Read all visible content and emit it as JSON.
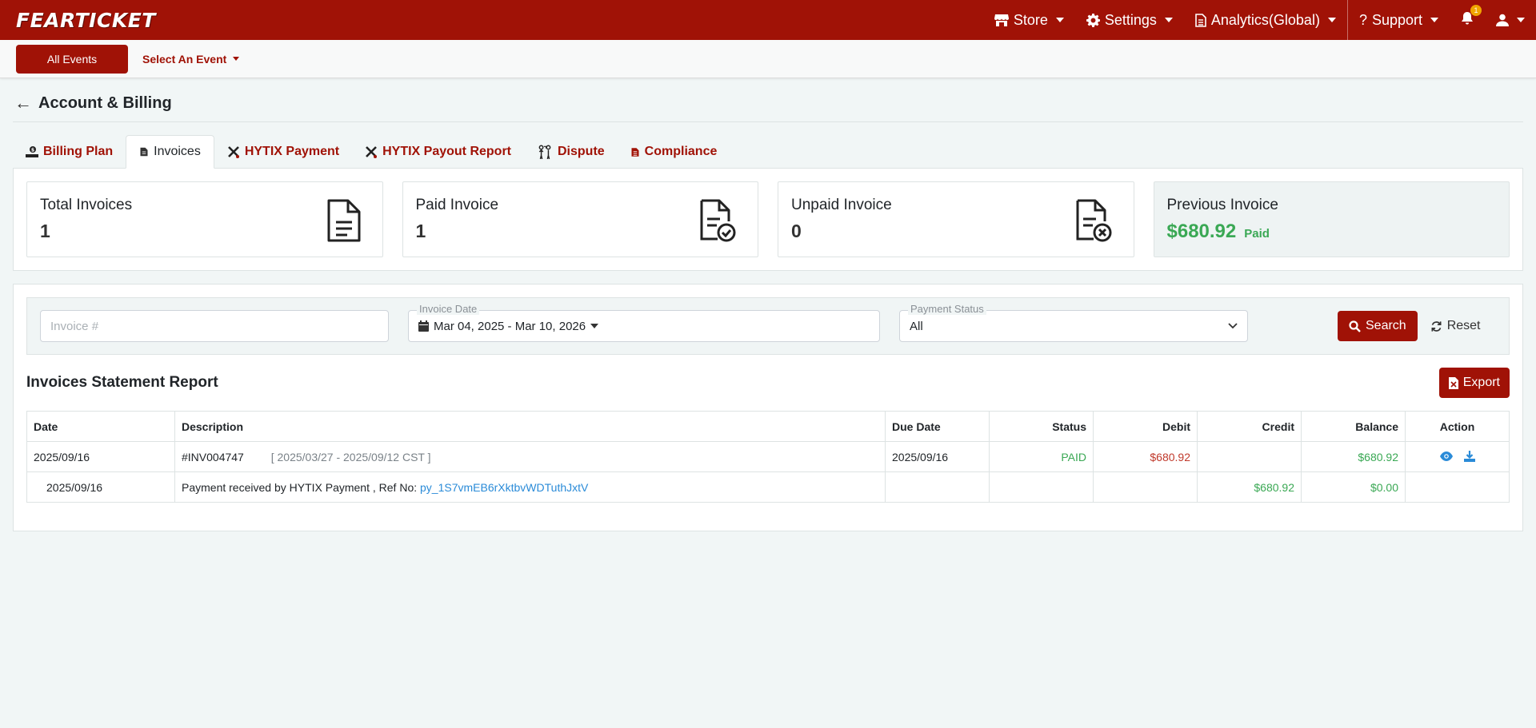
{
  "app": {
    "logo": "FEARTICKET"
  },
  "nav": {
    "store": "Store",
    "settings": "Settings",
    "analytics": "Analytics(Global)",
    "support": "Support",
    "notif_count": "1"
  },
  "subbar": {
    "all_events": "All Events",
    "select_event": "Select An Event"
  },
  "page": {
    "title": "Account & Billing"
  },
  "tabs": [
    {
      "label": "Billing Plan"
    },
    {
      "label": "Invoices"
    },
    {
      "label": "HYTIX Payment"
    },
    {
      "label": "HYTIX Payout Report"
    },
    {
      "label": "Dispute"
    },
    {
      "label": "Compliance"
    }
  ],
  "stats": {
    "total": {
      "label": "Total Invoices",
      "value": "1"
    },
    "paid": {
      "label": "Paid Invoice",
      "value": "1"
    },
    "unpaid": {
      "label": "Unpaid Invoice",
      "value": "0"
    },
    "previous": {
      "label": "Previous Invoice",
      "amount": "$680.92",
      "status": "Paid"
    }
  },
  "filters": {
    "invoice_placeholder": "Invoice #",
    "date_label": "Invoice Date",
    "date_value": "Mar 04, 2025 - Mar 10, 2026",
    "status_label": "Payment Status",
    "status_value": "All",
    "search": "Search",
    "reset": "Reset"
  },
  "report": {
    "title": "Invoices Statement Report",
    "export": "Export",
    "columns": [
      "Date",
      "Description",
      "Due Date",
      "Status",
      "Debit",
      "Credit",
      "Balance",
      "Action"
    ],
    "rows": [
      {
        "date": "2025/09/16",
        "invoice": "#INV004747",
        "period": "[ 2025/03/27 - 2025/09/12 CST ]",
        "due": "2025/09/16",
        "status": "PAID",
        "debit": "$680.92",
        "credit": "",
        "balance": "$680.92"
      },
      {
        "date": "2025/09/16",
        "desc": "Payment received by HYTIX Payment , Ref No:",
        "ref": "py_1S7vmEB6rXktbvWDTuthJxtV",
        "due": "",
        "status": "",
        "debit": "",
        "credit": "$680.92",
        "balance": "$0.00"
      }
    ]
  },
  "colors": {
    "brand": "#a01206",
    "success": "#3aa854",
    "link": "#2a8bd8"
  }
}
